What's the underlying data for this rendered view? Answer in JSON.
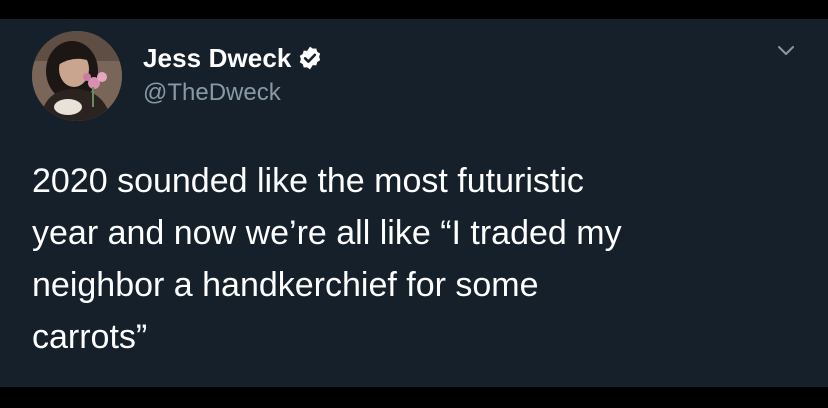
{
  "tweet": {
    "author": {
      "display_name": "Jess Dweck",
      "handle": "@TheDweck",
      "verified": true
    },
    "text": "2020 sounded like the most futuristic\nyear and now we’re all like “I traded my\nneighbor a handkerchief for some\ncarrots”",
    "menu_icon": "chevron-down-icon"
  },
  "colors": {
    "tweet_background": "#15202b",
    "outer_background": "#000000",
    "text_primary": "#ffffff",
    "text_secondary": "#8899a6"
  }
}
